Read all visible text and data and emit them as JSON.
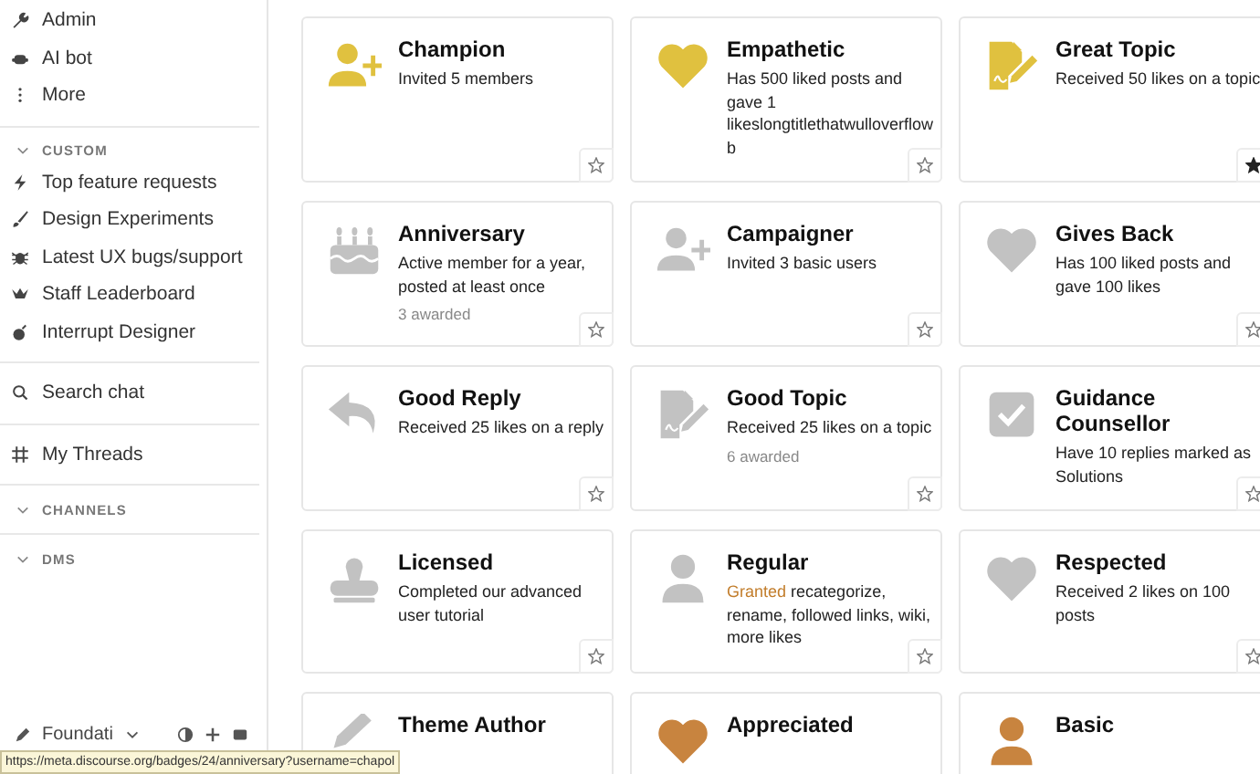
{
  "sidebar": {
    "entries": [
      {
        "kind": "link",
        "label": "Admin"
      },
      {
        "kind": "link",
        "label": "AI bot"
      },
      {
        "kind": "link",
        "label": "More"
      },
      {
        "kind": "divider"
      },
      {
        "kind": "header",
        "label": "CUSTOM",
        "expanded": true
      },
      {
        "kind": "link",
        "label": "Top feature requests"
      },
      {
        "kind": "link",
        "label": "Design Experiments"
      },
      {
        "kind": "link",
        "label": "Latest UX bugs/support"
      },
      {
        "kind": "link",
        "label": "Staff Leaderboard"
      },
      {
        "kind": "link",
        "label": "Interrupt Designer"
      },
      {
        "kind": "divider"
      },
      {
        "kind": "link",
        "label": "Search chat"
      },
      {
        "kind": "divider"
      },
      {
        "kind": "link",
        "label": "My Threads"
      },
      {
        "kind": "divider"
      },
      {
        "kind": "header",
        "label": "CHANNELS",
        "expanded": true
      },
      {
        "kind": "divider"
      },
      {
        "kind": "header",
        "label": "DMS",
        "expanded": true
      }
    ],
    "footer": {
      "label": "Foundati"
    }
  },
  "badges": [
    {
      "title": "Champion",
      "kind": "user-plus",
      "color": "#e0c13f",
      "description": "Invited 5 members",
      "favorite": false
    },
    {
      "title": "Empathetic",
      "kind": "heart",
      "color": "#e0c13f",
      "description": "Has 500 liked posts and gave 1 likeslongtitlethatwulloverflowb",
      "favorite": false
    },
    {
      "title": "Great Topic",
      "kind": "file-signature",
      "color": "#e0c13f",
      "description": "Received 50 likes on a topic",
      "favorite": true
    },
    {
      "title": "Anniversary",
      "kind": "cake",
      "color": "#c2c2c2",
      "description": "Active member for a year, posted at least once",
      "awarded": "3 awarded",
      "favorite": false
    },
    {
      "title": "Campaigner",
      "kind": "user-plus",
      "color": "#c2c2c2",
      "description": "Invited 3 basic users",
      "favorite": false
    },
    {
      "title": "Gives Back",
      "kind": "heart",
      "color": "#c2c2c2",
      "description": "Has 100 liked posts and gave 100 likes",
      "favorite": false
    },
    {
      "title": "Good Reply",
      "kind": "reply",
      "color": "#c2c2c2",
      "description": "Received 25 likes on a reply",
      "favorite": false
    },
    {
      "title": "Good Topic",
      "kind": "file-signature",
      "color": "#c2c2c2",
      "description": "Received 25 likes on a topic",
      "awarded": "6 awarded",
      "favorite": false
    },
    {
      "title": "Guidance Counsellor",
      "kind": "check-square",
      "color": "#c2c2c2",
      "description": "Have 10 replies marked as Solutions",
      "favorite": false
    },
    {
      "title": "Licensed",
      "kind": "stamp",
      "color": "#c2c2c2",
      "description": "Completed our advanced user tutorial",
      "favorite": false
    },
    {
      "title": "Regular",
      "kind": "user",
      "color": "#c2c2c2",
      "description_link": "Granted",
      "description": "recategorize, rename, followed links, wiki, more likes",
      "favorite": false
    },
    {
      "title": "Respected",
      "kind": "heart",
      "color": "#c2c2c2",
      "description": "Received 2 likes on 100 posts",
      "favorite": false
    },
    {
      "title": "Theme Author",
      "kind": "pencil",
      "color": "#c2c2c2"
    },
    {
      "title": "Appreciated",
      "kind": "heart",
      "color": "#c8843f"
    },
    {
      "title": "Basic",
      "kind": "user",
      "color": "#c8843f"
    }
  ],
  "status_url": "https://meta.discourse.org/badges/24/anniversary?username=chapol"
}
